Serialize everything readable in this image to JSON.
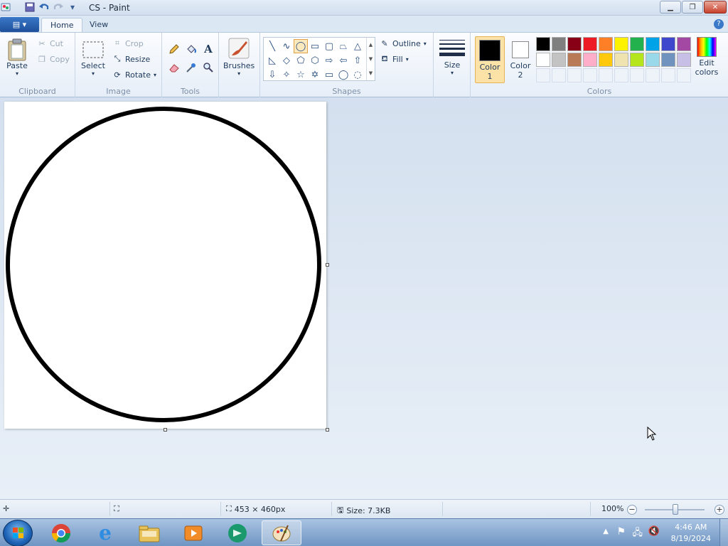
{
  "window": {
    "title": "CS - Paint"
  },
  "tabs": [
    {
      "label": "Home",
      "active": true
    },
    {
      "label": "View",
      "active": false
    }
  ],
  "ribbon": {
    "clipboard": {
      "label": "Clipboard",
      "paste": "Paste",
      "cut": "Cut",
      "copy": "Copy"
    },
    "image": {
      "label": "Image",
      "select": "Select",
      "crop": "Crop",
      "resize": "Resize",
      "rotate": "Rotate"
    },
    "tools": {
      "label": "Tools"
    },
    "brushes": {
      "label": "Brushes"
    },
    "shapes": {
      "label": "Shapes",
      "outline": "Outline",
      "fill": "Fill"
    },
    "size": {
      "label": "Size"
    },
    "colors": {
      "label": "Colors",
      "color1_line1": "Color",
      "color1_line2": "1",
      "color2_line1": "Color",
      "color2_line2": "2",
      "edit_line1": "Edit",
      "edit_line2": "colors",
      "color1_value": "#000000",
      "color2_value": "#ffffff",
      "palette_row1": [
        "#000000",
        "#7f7f7f",
        "#880015",
        "#ed1c24",
        "#ff7f27",
        "#fff200",
        "#22b14c",
        "#00a2e8",
        "#3f48cc",
        "#a349a4"
      ],
      "palette_row2": [
        "#ffffff",
        "#c3c3c3",
        "#b97a57",
        "#ffaec9",
        "#ffc90e",
        "#efe4b0",
        "#b5e61d",
        "#99d9ea",
        "#7092be",
        "#c8bfe7"
      ]
    }
  },
  "status": {
    "dimensions": "453 × 460px",
    "size": "Size: 7.3KB",
    "zoom": "100%"
  },
  "taskbar": {
    "time": "4:46 AM",
    "date": "8/19/2024"
  }
}
